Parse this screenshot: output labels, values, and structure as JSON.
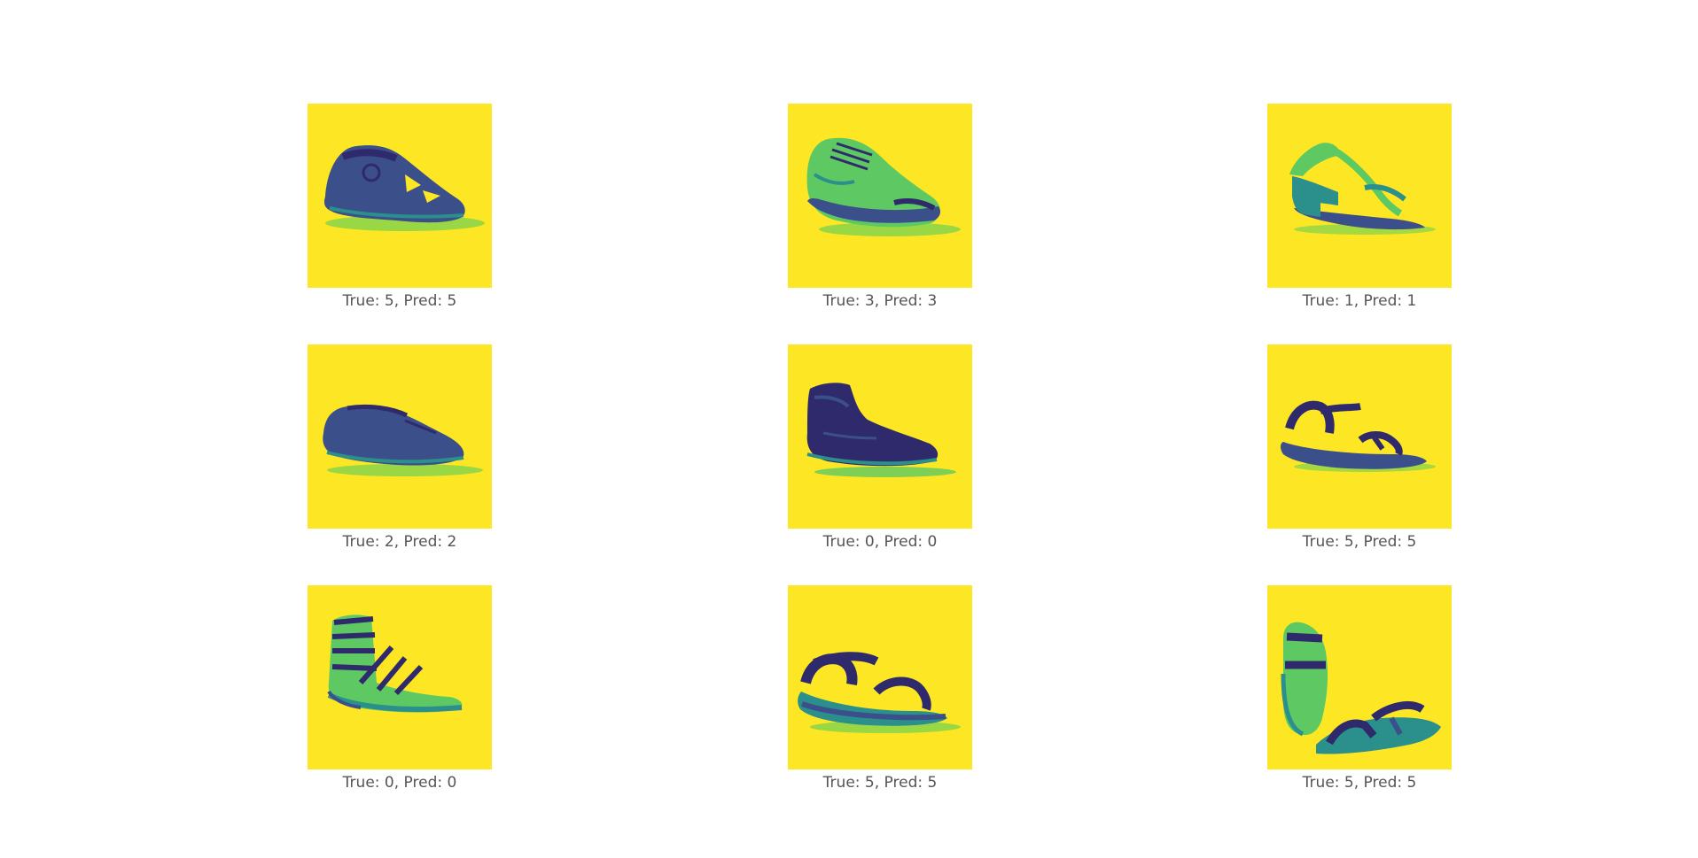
{
  "colors": {
    "background": "#fde725",
    "shoe_dark": "#3b4f8a",
    "shoe_deep": "#2f2a6b",
    "shoe_mid": "#2b8f8c",
    "shoe_light": "#5ec962",
    "shadow": "#7fd34e",
    "caption": "#555555"
  },
  "panels": [
    {
      "caption": "True: 5, Pred: 5",
      "icon": "sandal-icon"
    },
    {
      "caption": "True: 3, Pred: 3",
      "icon": "sneaker-icon"
    },
    {
      "caption": "True: 1, Pred: 1",
      "icon": "wedge-sandal-icon"
    },
    {
      "caption": "True: 2, Pred: 2",
      "icon": "loafer-icon"
    },
    {
      "caption": "True: 0, Pred: 0",
      "icon": "boot-icon"
    },
    {
      "caption": "True: 5, Pred: 5",
      "icon": "strap-sandal-icon"
    },
    {
      "caption": "True: 0, Pred: 0",
      "icon": "gladiator-sandal-icon"
    },
    {
      "caption": "True: 5, Pred: 5",
      "icon": "sport-sandal-icon"
    },
    {
      "caption": "True: 5, Pred: 5",
      "icon": "sandal-pair-icon"
    }
  ]
}
